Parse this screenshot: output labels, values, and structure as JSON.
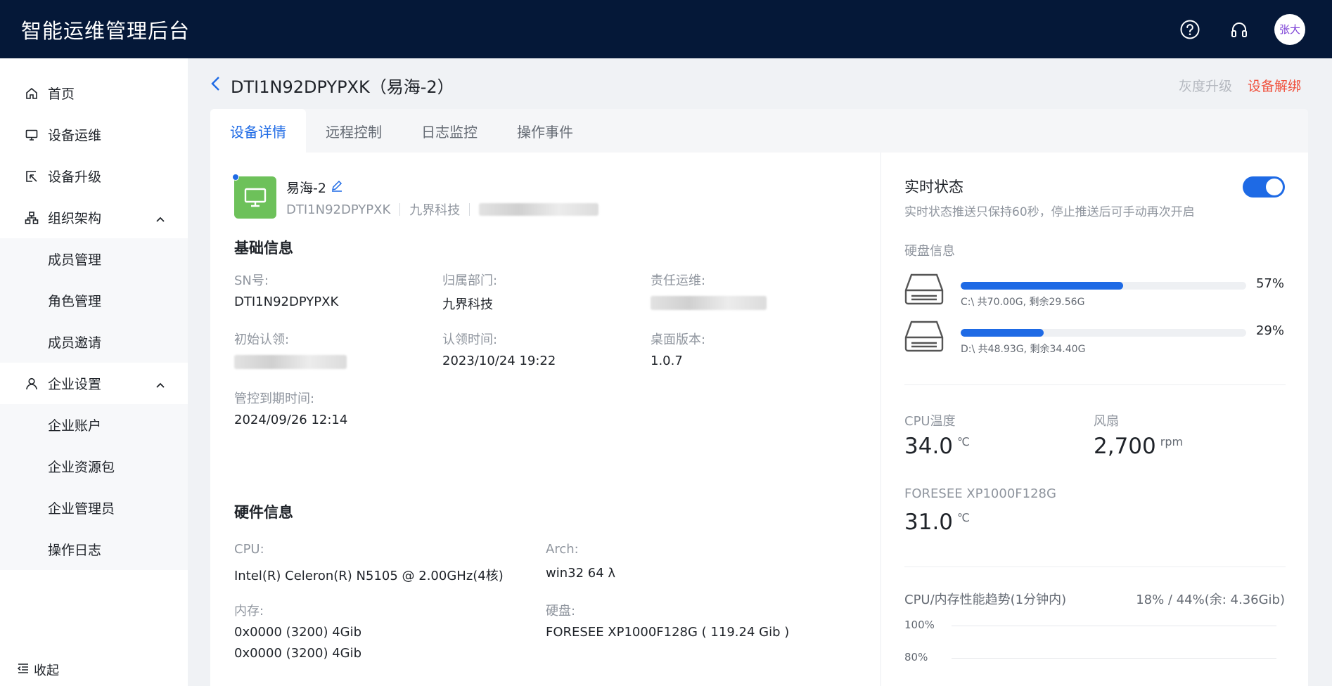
{
  "app": {
    "title": "智能运维管理后台",
    "user_initials": "张大"
  },
  "sidebar": {
    "items": [
      {
        "label": "首页",
        "icon": "home-icon"
      },
      {
        "label": "设备运维",
        "icon": "monitor-icon"
      },
      {
        "label": "设备升级",
        "icon": "upgrade-icon"
      }
    ],
    "org": {
      "label": "组织架构",
      "icon": "org-chart-icon",
      "children": [
        "成员管理",
        "角色管理",
        "成员邀请"
      ]
    },
    "enterprise": {
      "label": "企业设置",
      "icon": "user-icon",
      "children": [
        "企业账户",
        "企业资源包",
        "企业管理员",
        "操作日志"
      ]
    },
    "collapse_label": "收起"
  },
  "page": {
    "title": "DTI1N92DPYPXK（易海-2）",
    "actions": {
      "gray_upgrade": "灰度升级",
      "unbind": "设备解绑"
    }
  },
  "tabs": [
    "设备详情",
    "远程控制",
    "日志监控",
    "操作事件"
  ],
  "device": {
    "name": "易海-2",
    "sn": "DTI1N92DPYPXK",
    "department": "九界科技"
  },
  "basic_info": {
    "title": "基础信息",
    "sn_label": "SN号:",
    "sn_value": "DTI1N92DPYPXK",
    "dept_label": "归属部门:",
    "dept_value": "九界科技",
    "owner_label": "责任运维:",
    "claim_label": "初始认领:",
    "claim_time_label": "认领时间:",
    "claim_time_value": "2023/10/24 19:22",
    "desktop_label": "桌面版本:",
    "desktop_value": "1.0.7",
    "expiry_label": "管控到期时间:",
    "expiry_value": "2024/09/26 12:14"
  },
  "hardware": {
    "title": "硬件信息",
    "cpu_label": "CPU:",
    "cpu_value": "Intel(R) Celeron(R) N5105 @ 2.00GHz(4核)",
    "arch_label": "Arch:",
    "arch_value": "win32 64 λ",
    "mem_label": "内存:",
    "mem_values": [
      "0x0000 (3200) 4Gib",
      "0x0000 (3200) 4Gib"
    ],
    "disk_label": "硬盘:",
    "disk_value": "FORESEE XP1000F128G ( 119.24 Gib )"
  },
  "realtime": {
    "title": "实时状态",
    "desc": "实时状态推送只保持60秒，停止推送后可手动再次开启",
    "enabled": true,
    "disk_title": "硬盘信息",
    "disks": [
      {
        "percent": "57%",
        "fill": 0.57,
        "text": "C:\\ 共70.00G, 剩余29.56G"
      },
      {
        "percent": "29%",
        "fill": 0.29,
        "text": "D:\\ 共48.93G, 剩余34.40G"
      }
    ],
    "cpu_temp_label": "CPU温度",
    "cpu_temp_value": "34.0",
    "cpu_temp_unit": "℃",
    "fan_label": "风扇",
    "fan_value": "2,700",
    "fan_unit": "rpm",
    "ssd_label": "FORESEE XP1000F128G",
    "ssd_value": "31.0",
    "ssd_unit": "℃",
    "trend_title": "CPU/内存性能趋势(1分钟内)",
    "trend_value": "18% / 44%(余: 4.36Gib)",
    "y_ticks": [
      "100%",
      "80%"
    ]
  },
  "colors": {
    "topbar": "#051838",
    "accent": "#1e6ae5",
    "danger": "#f0503c",
    "device_icon": "#6dc15a"
  }
}
